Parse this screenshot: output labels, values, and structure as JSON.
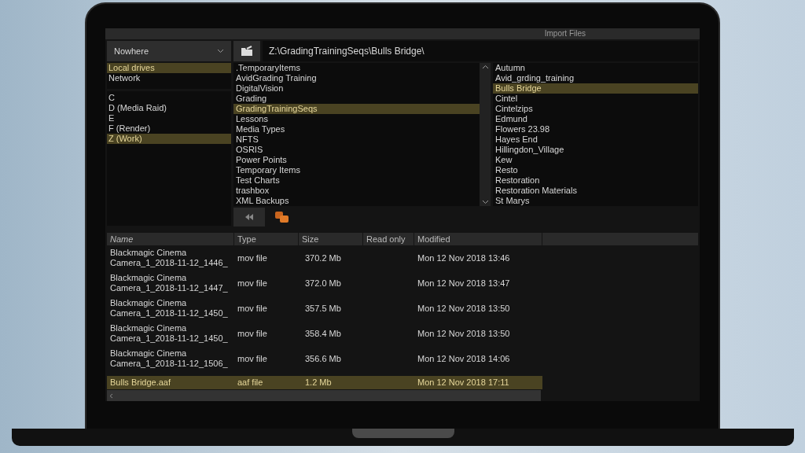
{
  "window": {
    "title": "Import Files"
  },
  "location_dropdown": {
    "value": "Nowhere"
  },
  "path_field": {
    "value": "Z:\\GradingTrainingSeqs\\Bulls Bridge\\"
  },
  "sources": [
    {
      "label": "Local drives",
      "selected": true
    },
    {
      "label": "Network",
      "selected": false
    }
  ],
  "drives": [
    {
      "label": "C",
      "selected": false
    },
    {
      "label": "D (Media Raid)",
      "selected": false
    },
    {
      "label": "E",
      "selected": false
    },
    {
      "label": "F (Render)",
      "selected": false
    },
    {
      "label": "Z (Work)",
      "selected": true
    }
  ],
  "folders": [
    {
      "label": ".TemporaryItems",
      "selected": false
    },
    {
      "label": "AvidGrading Training",
      "selected": false
    },
    {
      "label": "DigitalVision",
      "selected": false
    },
    {
      "label": "Grading",
      "selected": false
    },
    {
      "label": "GradingTrainingSeqs",
      "selected": true
    },
    {
      "label": "Lessons",
      "selected": false
    },
    {
      "label": "Media Types",
      "selected": false
    },
    {
      "label": "NFTS",
      "selected": false
    },
    {
      "label": "OSRIS",
      "selected": false
    },
    {
      "label": "Power Points",
      "selected": false
    },
    {
      "label": "Temporary Items",
      "selected": false
    },
    {
      "label": "Test Charts",
      "selected": false
    },
    {
      "label": "trashbox",
      "selected": false
    },
    {
      "label": "XML Backups",
      "selected": false
    }
  ],
  "subfolders": [
    {
      "label": "Autumn",
      "selected": false
    },
    {
      "label": "Avid_grding_training",
      "selected": false
    },
    {
      "label": "Bulls Bridge",
      "selected": true
    },
    {
      "label": "Cintel",
      "selected": false
    },
    {
      "label": "Cintelzips",
      "selected": false
    },
    {
      "label": "Edmund",
      "selected": false
    },
    {
      "label": "Flowers 23.98",
      "selected": false
    },
    {
      "label": "Hayes End",
      "selected": false
    },
    {
      "label": "Hillingdon_Village",
      "selected": false
    },
    {
      "label": "Kew",
      "selected": false
    },
    {
      "label": "Resto",
      "selected": false
    },
    {
      "label": "Restoration",
      "selected": false
    },
    {
      "label": "Restoration Materials",
      "selected": false
    },
    {
      "label": "St Marys",
      "selected": false
    }
  ],
  "table": {
    "columns": [
      "Name",
      "Type",
      "Size",
      "Read only",
      "Modified"
    ],
    "rows": [
      {
        "name": [
          "Blackmagic Cinema",
          "Camera_1_2018-11-12_1446_"
        ],
        "type": "mov file",
        "size": "370.2 Mb",
        "modified": "Mon 12 Nov 2018 13:46",
        "selected": false
      },
      {
        "name": [
          "Blackmagic Cinema",
          "Camera_1_2018-11-12_1447_"
        ],
        "type": "mov file",
        "size": "372.0 Mb",
        "modified": "Mon 12 Nov 2018 13:47",
        "selected": false
      },
      {
        "name": [
          "Blackmagic Cinema",
          "Camera_1_2018-11-12_1450_"
        ],
        "type": "mov file",
        "size": "357.5 Mb",
        "modified": "Mon 12 Nov 2018 13:50",
        "selected": false
      },
      {
        "name": [
          "Blackmagic Cinema",
          "Camera_1_2018-11-12_1450_"
        ],
        "type": "mov file",
        "size": "358.4 Mb",
        "modified": "Mon 12 Nov 2018 13:50",
        "selected": false
      },
      {
        "name": [
          "Blackmagic Cinema",
          "Camera_1_2018-11-12_1506_"
        ],
        "type": "mov file",
        "size": "356.6 Mb",
        "modified": "Mon 12 Nov 2018 14:06",
        "selected": false
      },
      {
        "name": [
          "Bulls Bridge.aaf"
        ],
        "type": "aaf file",
        "size": "1.2 Mb",
        "modified": "Mon 12 Nov 2018 17:11",
        "selected": true
      }
    ]
  }
}
